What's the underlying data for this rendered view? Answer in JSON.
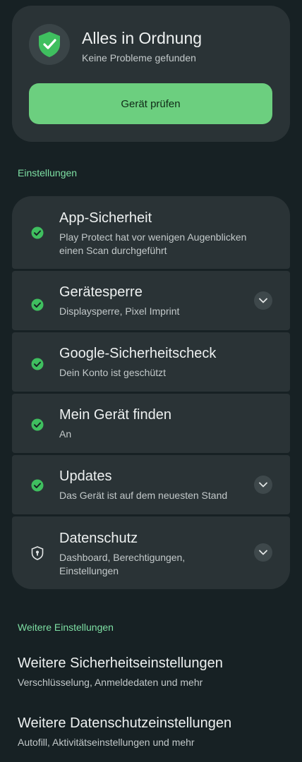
{
  "status": {
    "title": "Alles in Ordnung",
    "subtitle": "Keine Probleme gefunden",
    "button_label": "Gerät prüfen",
    "icon": "shield-check-icon"
  },
  "settings": {
    "heading": "Einstellungen",
    "items": [
      {
        "title": "App-Sicherheit",
        "subtitle": "Play Protect hat vor wenigen Augenblicken einen Scan durchgeführt",
        "icon": "check-circle-icon",
        "expandable": false
      },
      {
        "title": "Gerätesperre",
        "subtitle": "Displaysperre, Pixel Imprint",
        "icon": "check-circle-icon",
        "expandable": true
      },
      {
        "title": "Google-Sicherheitscheck",
        "subtitle": "Dein Konto ist geschützt",
        "icon": "check-circle-icon",
        "expandable": false
      },
      {
        "title": "Mein Gerät finden",
        "subtitle": "An",
        "icon": "check-circle-icon",
        "expandable": false
      },
      {
        "title": "Updates",
        "subtitle": "Das Gerät ist auf dem neuesten Stand",
        "icon": "check-circle-icon",
        "expandable": true
      },
      {
        "title": "Datenschutz",
        "subtitle": "Dashboard, Berechtigungen, Einstellungen",
        "icon": "privacy-shield-icon",
        "expandable": true
      }
    ]
  },
  "more": {
    "heading": "Weitere Einstellungen",
    "items": [
      {
        "title": "Weitere Sicherheitseinstellungen",
        "subtitle": "Verschlüsselung, Anmeldedaten und mehr"
      },
      {
        "title": "Weitere Datenschutzeinstellungen",
        "subtitle": "Autofill, Aktivitätseinstellungen und mehr"
      }
    ]
  },
  "colors": {
    "background": "#172124",
    "card": "#2a3336",
    "accent_green": "#6ccf7f",
    "section_label": "#7ee0a4",
    "check_green": "#3fbf5f"
  }
}
